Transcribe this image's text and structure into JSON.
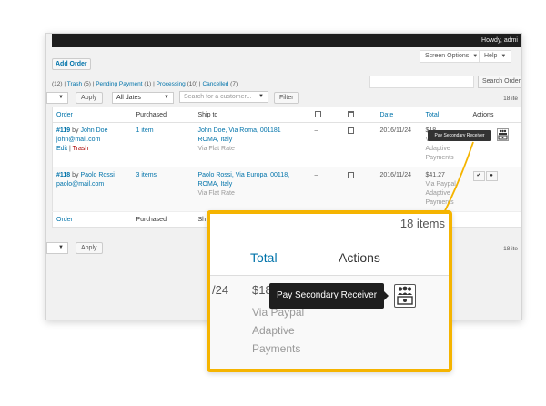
{
  "adminbar": {
    "greeting": "Howdy, admi"
  },
  "header": {
    "add_order": "Add Order",
    "screen_options": "Screen Options",
    "help": "Help"
  },
  "views": {
    "all_fragment": "(12)",
    "trash": "Trash",
    "trash_count": "(5)",
    "pending": "Pending Payment",
    "pending_count": "(1)",
    "processing": "Processing",
    "processing_count": "(10)",
    "cancelled": "Cancelled",
    "cancelled_count": "(7)"
  },
  "search": {
    "button": "Search Order"
  },
  "filters": {
    "apply": "Apply",
    "dates": "All dates",
    "customer_placeholder": "Search for a customer...",
    "filter": "Filter",
    "count": "18 ite"
  },
  "table": {
    "columns": {
      "order": "Order",
      "purchased": "Purchased",
      "ship_to": "Ship to",
      "date": "Date",
      "total": "Total",
      "actions": "Actions"
    },
    "rows": [
      {
        "order_id": "#119",
        "by": "by",
        "customer": "John Doe",
        "email": "john@mail.com",
        "edit": "Edit",
        "trash": "Trash",
        "purchased": "1 item",
        "address": "John Doe, Via Roma, 001181",
        "city": "ROMA, Italy",
        "shipping": "Via Flat Rate",
        "dash": "–",
        "date": "2016/11/24",
        "total": "$18",
        "method1": "Via P",
        "method2": "Adaptive",
        "method3": "Payments"
      },
      {
        "order_id": "#118",
        "by": "by",
        "customer": "Paolo Rossi",
        "email": "paolo@mail.com",
        "purchased": "3 items",
        "address": "Paolo Rossi, Via Europa, 00118,",
        "city": "ROMA, Italy",
        "shipping": "Via Flat Rate",
        "dash": "–",
        "date": "2016/11/24",
        "total": "$41.27",
        "method1": "Via Paypal",
        "method2": "Adaptive",
        "method3": "Payments"
      }
    ],
    "footer": {
      "order": "Order",
      "purchased": "Purchased",
      "ship_to": "Sh"
    }
  },
  "bottom": {
    "apply": "Apply",
    "count": "18 ite"
  },
  "tooltip": {
    "label": "Pay Secondary Receiver"
  },
  "zoom": {
    "count": "18 items",
    "total": "Total",
    "actions": "Actions",
    "date_fragment": "/24",
    "amount": "$18",
    "method1": "Via Paypal",
    "method2": "Adaptive",
    "method3": "Payments",
    "tooltip": "Pay Secondary Receiver"
  },
  "colors": {
    "accent": "#0073aa",
    "callout": "#f5b400",
    "adminbar": "#1e1e1e"
  },
  "icons": [
    "image-icon",
    "calendar-icon",
    "pay-receiver-icon",
    "complete-icon",
    "view-icon"
  ]
}
